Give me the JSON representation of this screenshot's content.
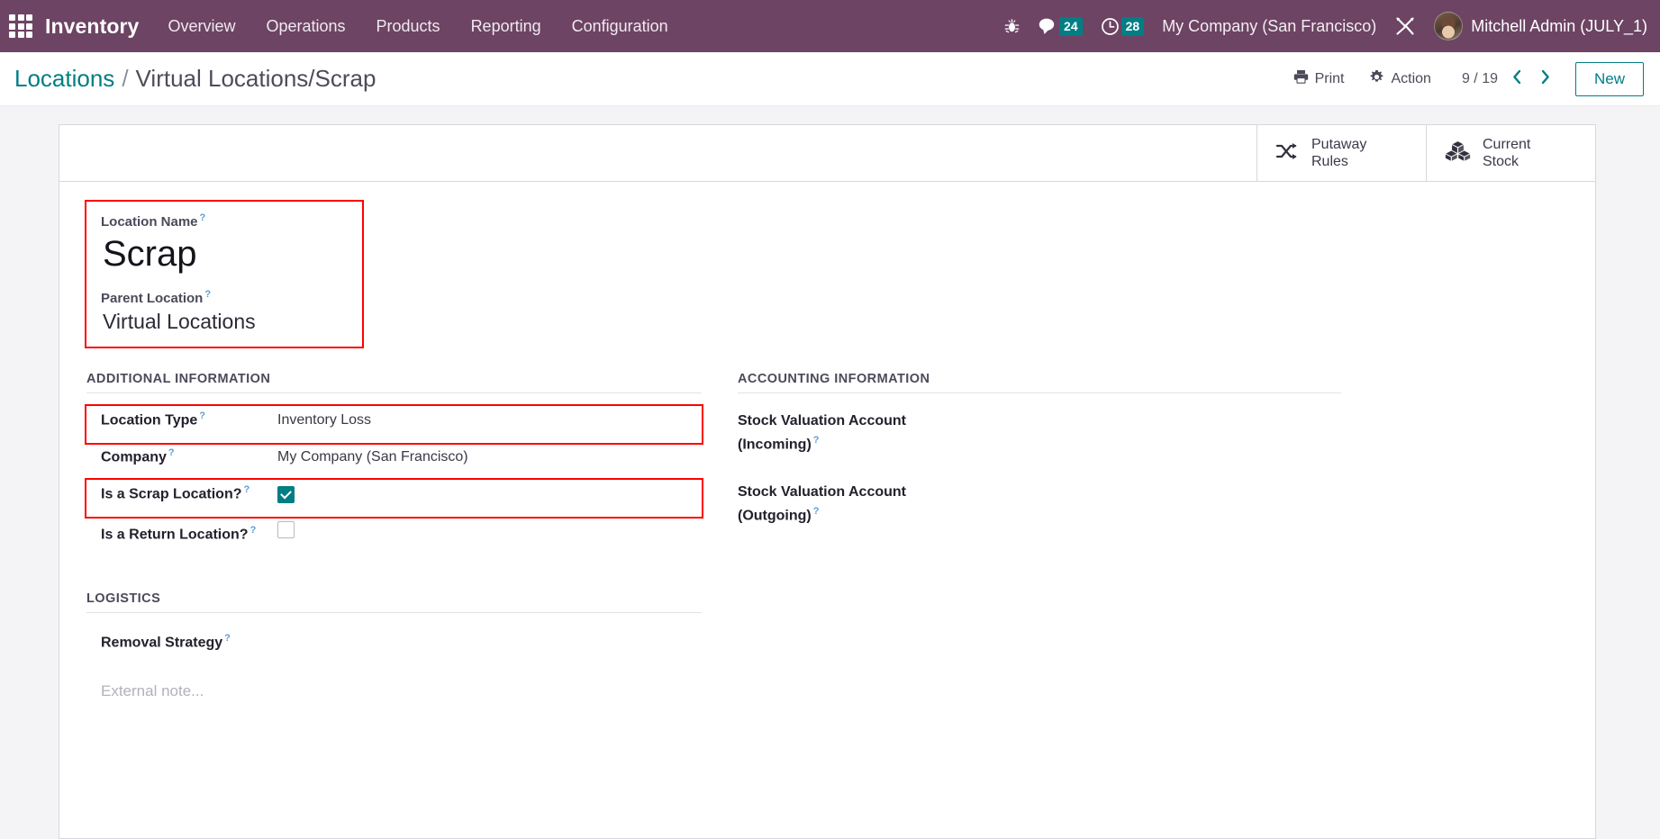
{
  "navbar": {
    "apps_icon": "apps-grid-icon",
    "brand": "Inventory",
    "menu": [
      {
        "label": "Overview"
      },
      {
        "label": "Operations"
      },
      {
        "label": "Products"
      },
      {
        "label": "Reporting"
      },
      {
        "label": "Configuration"
      }
    ],
    "bug_icon": "bug-icon",
    "messages": {
      "icon": "chat-bubble-icon",
      "count": "24"
    },
    "activities": {
      "icon": "clock-icon",
      "count": "28"
    },
    "company": "My Company (San Francisco)",
    "tools_icon": "wrench-screwdriver-icon",
    "user": "Mitchell Admin (JULY_1)",
    "accent_color": "#6d4464",
    "badge_color": "#017e84"
  },
  "control_panel": {
    "breadcrumb_root": "Locations",
    "breadcrumb_separator": "/",
    "breadcrumb_current": "Virtual Locations/Scrap",
    "print_label": "Print",
    "print_icon": "printer-icon",
    "action_label": "Action",
    "action_icon": "gear-icon",
    "pager": "9 / 19",
    "prev_icon": "chevron-left-icon",
    "next_icon": "chevron-right-icon",
    "new_label": "New",
    "accent_color": "#017e84"
  },
  "smart_buttons": [
    {
      "icon": "shuffle-icon",
      "line1": "Putaway",
      "line2": "Rules"
    },
    {
      "icon": "boxes-icon",
      "line1": "Current",
      "line2": "Stock"
    }
  ],
  "title_card": {
    "location_name_label": "Location Name",
    "location_name_value": "Scrap",
    "parent_location_label": "Parent Location",
    "parent_location_value": "Virtual Locations",
    "highlight_color": "#ff0000"
  },
  "additional_information": {
    "section_title": "ADDITIONAL INFORMATION",
    "rows": [
      {
        "label": "Location Type",
        "value": "Inventory Loss",
        "type": "text",
        "highlighted": true
      },
      {
        "label": "Company",
        "value": "My Company (San Francisco)",
        "type": "text",
        "highlighted": false
      },
      {
        "label": "Is a Scrap Location?",
        "value": "",
        "type": "checkbox",
        "checked": true,
        "highlighted": true
      },
      {
        "label": "Is a Return Location?",
        "value": "",
        "type": "checkbox",
        "checked": false,
        "highlighted": false
      }
    ]
  },
  "logistics": {
    "section_title": "LOGISTICS",
    "rows": [
      {
        "label": "Removal Strategy",
        "value": "",
        "type": "text"
      }
    ]
  },
  "accounting_information": {
    "section_title": "ACCOUNTING INFORMATION",
    "rows": [
      {
        "label": "Stock Valuation Account (Incoming)",
        "value": ""
      },
      {
        "label": "Stock Valuation Account (Outgoing)",
        "value": ""
      }
    ]
  },
  "note": {
    "placeholder": "External note..."
  },
  "help_marker": "?"
}
